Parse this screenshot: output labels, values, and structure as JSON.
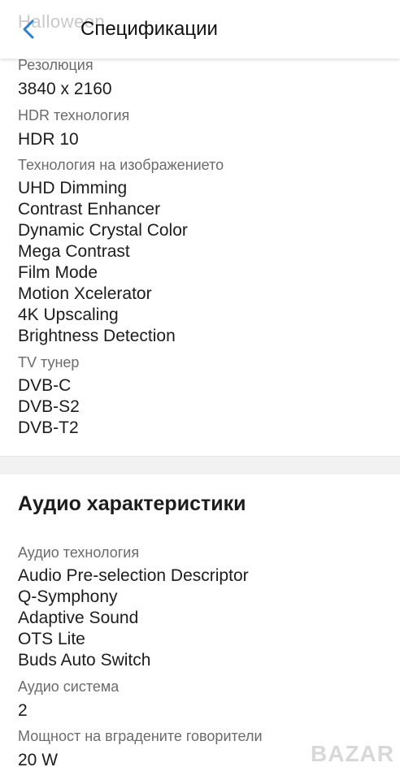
{
  "header": {
    "ghost_text": "Halloween",
    "title": "Спецификации"
  },
  "video_specs": [
    {
      "label": "Резолюция",
      "values": [
        "3840 x 2160"
      ]
    },
    {
      "label": "HDR технология",
      "values": [
        "HDR 10"
      ]
    },
    {
      "label": "Технология на изображението",
      "values": [
        "UHD Dimming",
        "Contrast Enhancer",
        "Dynamic Crystal Color",
        "Mega Contrast",
        "Film Mode",
        "Motion Xcelerator",
        "4K Upscaling",
        "Brightness Detection"
      ]
    },
    {
      "label": "TV тунер",
      "values": [
        "DVB-C",
        "DVB-S2",
        "DVB-T2"
      ]
    }
  ],
  "audio": {
    "title": "Аудио характеристики",
    "specs": [
      {
        "label": "Аудио технология",
        "values": [
          "Audio Pre-selection Descriptor",
          "Q-Symphony",
          "Adaptive Sound",
          "OTS Lite",
          "Buds Auto Switch"
        ]
      },
      {
        "label": "Аудио система",
        "values": [
          "2"
        ]
      },
      {
        "label": "Мощност на вградените говорители",
        "values": [
          "20 W"
        ]
      }
    ]
  },
  "watermark": "BAZAR"
}
